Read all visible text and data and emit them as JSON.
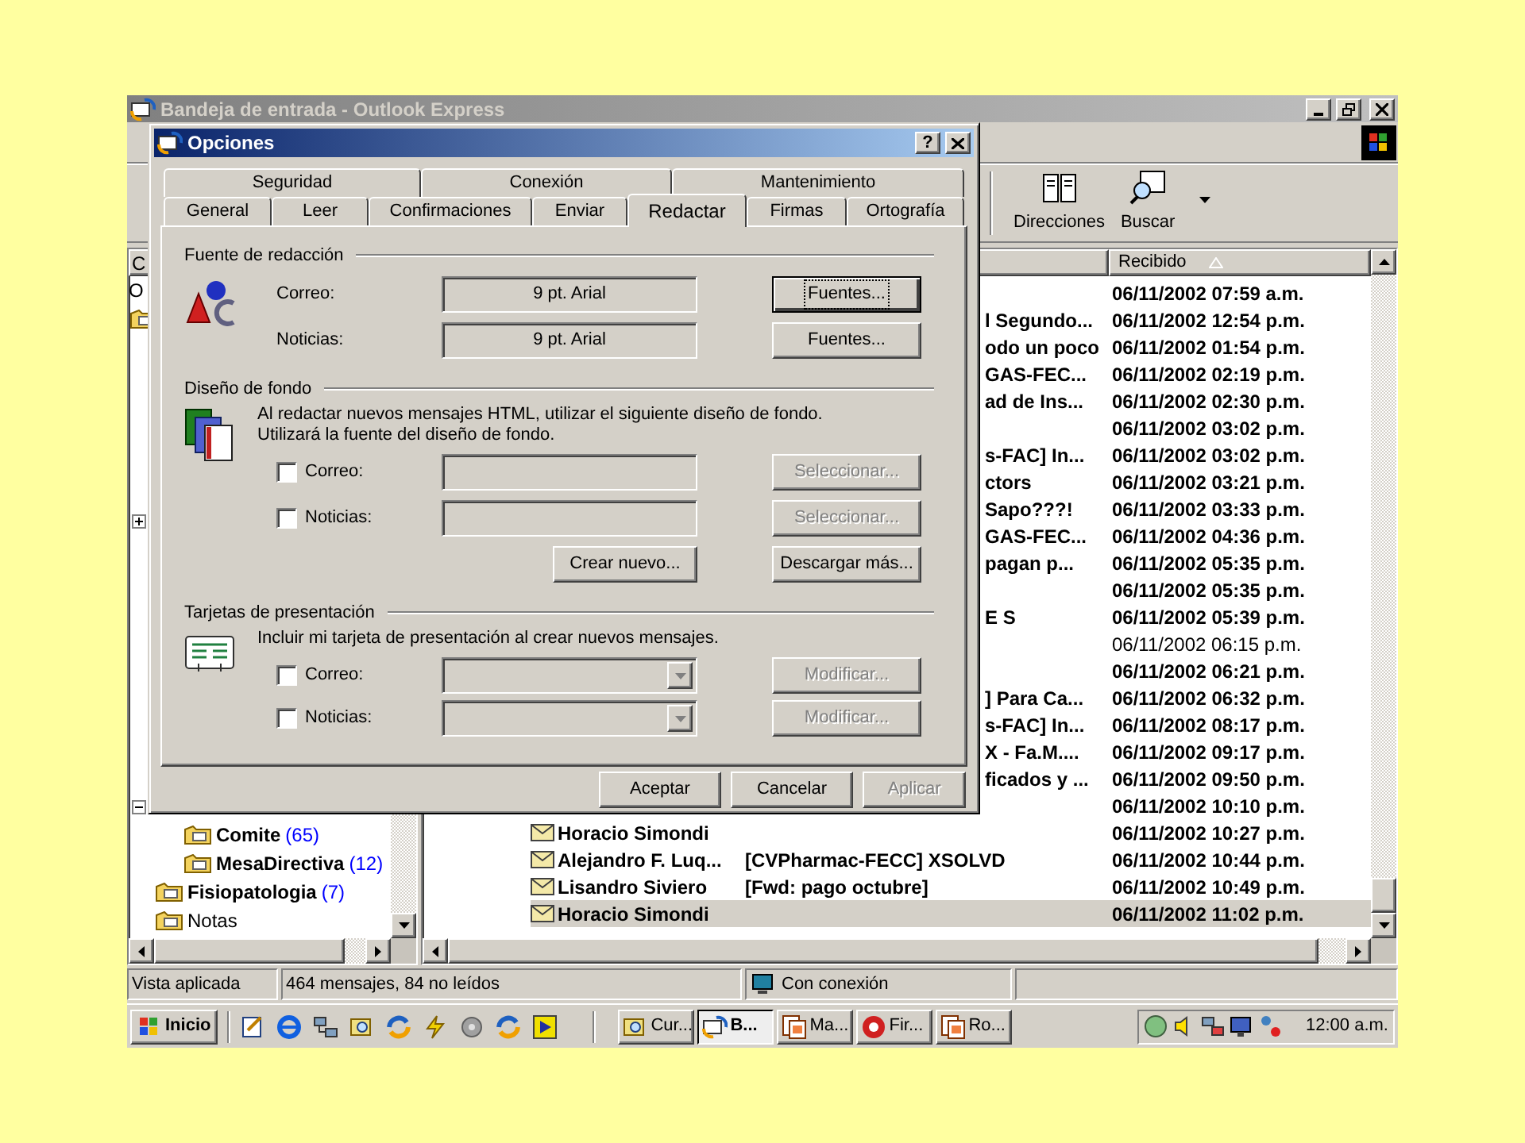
{
  "outlook_window": {
    "title": "Bandeja de entrada - Outlook Express"
  },
  "toolbar": [
    {
      "label": "Direcciones",
      "kind": "book"
    },
    {
      "label": "Buscar",
      "kind": "find"
    }
  ],
  "folder_pane": {
    "header": "C",
    "tree": {
      "name": "O",
      "children": [
        {
          "expanded": false
        },
        {
          "expanded": true,
          "children": [
            {
              "name": "Comite",
              "count": "(65)"
            },
            {
              "name": "MesaDirectiva",
              "count": "(12)"
            }
          ]
        },
        {
          "name": "Fisiopatologia",
          "count": "(7)"
        },
        {
          "name": "Notas"
        }
      ]
    }
  },
  "message_list": {
    "header": "Recibido",
    "rows": [
      {
        "subject": "",
        "received": "06/11/2002 07:59 a.m.",
        "unread": true,
        "selected": false
      },
      {
        "subject": "l Segundo...",
        "received": "06/11/2002 12:54 p.m.",
        "unread": true,
        "selected": false
      },
      {
        "subject": "odo un poco",
        "received": "06/11/2002 01:54 p.m.",
        "unread": true,
        "selected": false
      },
      {
        "subject": "GAS-FEC...",
        "received": "06/11/2002 02:19 p.m.",
        "unread": true,
        "selected": false
      },
      {
        "subject": "ad de Ins...",
        "received": "06/11/2002 02:30 p.m.",
        "unread": true,
        "selected": false
      },
      {
        "subject": "",
        "received": "06/11/2002 03:02 p.m.",
        "unread": true,
        "selected": false
      },
      {
        "subject": "s-FAC] In...",
        "received": "06/11/2002 03:02 p.m.",
        "unread": true,
        "selected": false
      },
      {
        "subject": "ctors",
        "received": "06/11/2002 03:21 p.m.",
        "unread": true,
        "selected": false
      },
      {
        "subject": "Sapo???!",
        "received": "06/11/2002 03:33 p.m.",
        "unread": true,
        "selected": false
      },
      {
        "subject": "GAS-FEC...",
        "received": "06/11/2002 04:36 p.m.",
        "unread": true,
        "selected": false
      },
      {
        "subject": "pagan p...",
        "received": "06/11/2002 05:35 p.m.",
        "unread": true,
        "selected": false
      },
      {
        "subject": "",
        "received": "06/11/2002 05:35 p.m.",
        "unread": true,
        "selected": false
      },
      {
        "subject": "E S",
        "received": "06/11/2002 05:39 p.m.",
        "unread": true,
        "selected": false
      },
      {
        "subject": "",
        "received": "06/11/2002 06:15 p.m.",
        "unread": false,
        "selected": false
      },
      {
        "subject": "",
        "received": "06/11/2002 06:21 p.m.",
        "unread": true,
        "selected": false
      },
      {
        "subject": "] Para Ca...",
        "received": "06/11/2002 06:32 p.m.",
        "unread": true,
        "selected": false
      },
      {
        "subject": "s-FAC] In...",
        "received": "06/11/2002 08:17 p.m.",
        "unread": true,
        "selected": false
      },
      {
        "subject": "X - Fa.M....",
        "received": "06/11/2002 09:17 p.m.",
        "unread": true,
        "selected": false
      },
      {
        "subject": "ficados y ...",
        "received": "06/11/2002 09:50 p.m.",
        "unread": true,
        "selected": false
      },
      {
        "subject": "",
        "received": "06/11/2002 10:10 p.m.",
        "unread": true,
        "selected": false
      },
      {
        "from": "Horacio Simondi",
        "subject": "",
        "received": "06/11/2002 10:27 p.m.",
        "unread": true,
        "selected": false
      },
      {
        "from": "Alejandro F. Luq...",
        "subject": "[CVPharmac-FECC] XSOLVD",
        "received": "06/11/2002 10:44 p.m.",
        "unread": true,
        "selected": false
      },
      {
        "from": "Lisandro Siviero",
        "subject": "[Fwd: pago octubre]",
        "received": "06/11/2002 10:49 p.m.",
        "unread": true,
        "selected": false
      },
      {
        "from": "Horacio Simondi",
        "subject": "",
        "received": "06/11/2002 11:02 p.m.",
        "unread": true,
        "selected": true
      }
    ]
  },
  "options_dialog": {
    "title": "Opciones",
    "help": "?",
    "tabs_back": [
      {
        "label": "Seguridad",
        "selected": false
      },
      {
        "label": "Conexión",
        "selected": false
      },
      {
        "label": "Mantenimiento",
        "selected": false
      }
    ],
    "tabs_front": [
      {
        "label": "General",
        "selected": false
      },
      {
        "label": "Leer",
        "selected": false
      },
      {
        "label": "Confirmaciones",
        "selected": false
      },
      {
        "label": "Enviar",
        "selected": false
      },
      {
        "label": "Redactar",
        "selected": true
      },
      {
        "label": "Firmas",
        "selected": false
      },
      {
        "label": "Ortografía",
        "selected": false
      }
    ],
    "sections": [
      {
        "kind": "fonts",
        "title": "Fuente de redacción",
        "rows": [
          {
            "label": "Correo:",
            "value": "9 pt. Arial",
            "button": "Fuentes...",
            "focused": true
          },
          {
            "label": "Noticias:",
            "value": "9 pt. Arial",
            "button": "Fuentes...",
            "focused": false
          }
        ]
      },
      {
        "kind": "stationery",
        "title": "Diseño de fondo",
        "description": [
          "Al redactar nuevos mensajes HTML, utilizar el siguiente diseño de fondo.",
          "Utilizará la fuente del diseño de fondo."
        ],
        "rows": [
          {
            "label": "Correo:",
            "checked": false,
            "button": "Seleccionar...",
            "button_disabled": true
          },
          {
            "label": "Noticias:",
            "checked": false,
            "button": "Seleccionar...",
            "button_disabled": true
          }
        ],
        "extra_buttons": [
          "Crear nuevo...",
          "Descargar más..."
        ]
      },
      {
        "kind": "card",
        "title": "Tarjetas de presentación",
        "description": [
          "Incluir mi tarjeta de presentación al crear nuevos mensajes."
        ],
        "rows": [
          {
            "label": "Correo:",
            "checked": false,
            "button": "Modificar...",
            "button_disabled": true
          },
          {
            "label": "Noticias:",
            "checked": false,
            "button": "Modificar...",
            "button_disabled": true
          }
        ]
      }
    ],
    "buttons": [
      {
        "label": "Aceptar",
        "disabled": false
      },
      {
        "label": "Cancelar",
        "disabled": false
      },
      {
        "label": "Aplicar",
        "disabled": true
      }
    ]
  },
  "status_bar": [
    {
      "text": "Vista aplicada",
      "kind": "plain"
    },
    {
      "text": "464 mensajes, 84 no leídos",
      "kind": "plain"
    },
    {
      "text": "Con conexión",
      "kind": "online"
    }
  ],
  "taskbar": {
    "start": "Inicio",
    "tasks": [
      {
        "label": "Cur...",
        "kind": "find",
        "selected": false
      },
      {
        "label": "B...",
        "kind": "mail",
        "selected": true
      },
      {
        "label": "Ma...",
        "kind": "doc",
        "selected": false
      },
      {
        "label": "Fir...",
        "kind": "browser",
        "selected": false
      },
      {
        "label": "Ro...",
        "kind": "doc",
        "selected": false
      }
    ],
    "clock": "12:00 a.m."
  }
}
